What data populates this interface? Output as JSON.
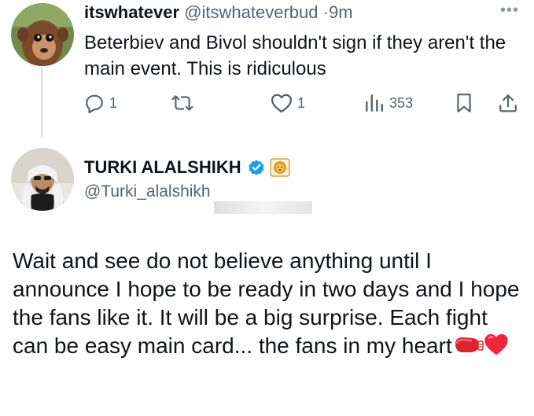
{
  "reply": {
    "name": "itswhatever",
    "handle": "@itswhateverbud",
    "separator": "·",
    "time": "9m",
    "text": "Beterbiev and Bivol shouldn't sign if they aren't the main event. This is ridiculous",
    "more_icon": "more-icon",
    "actions": {
      "reply_count": "1",
      "retweet_count": "",
      "like_count": "1",
      "views_count": "353"
    }
  },
  "tweet": {
    "name": "TURKI ALALSHIKH",
    "handle": "@Turki_alalshikh",
    "verified_icon": "verified-badge-icon",
    "affiliate_icon": "lion-affiliate-icon",
    "text_main": "Wait and see do not believe anything until I announce I hope to be ready in two days and I hope the fans like it. It will be a big surprise. Each fight can be easy main card... the fans in my heart",
    "emojis": [
      "boxing-glove-icon",
      "red-heart-icon"
    ]
  },
  "colors": {
    "text_primary": "#0f1419",
    "text_secondary": "#536471",
    "verified_blue": "#1d9bf0",
    "thread_line": "#cfd9de"
  }
}
